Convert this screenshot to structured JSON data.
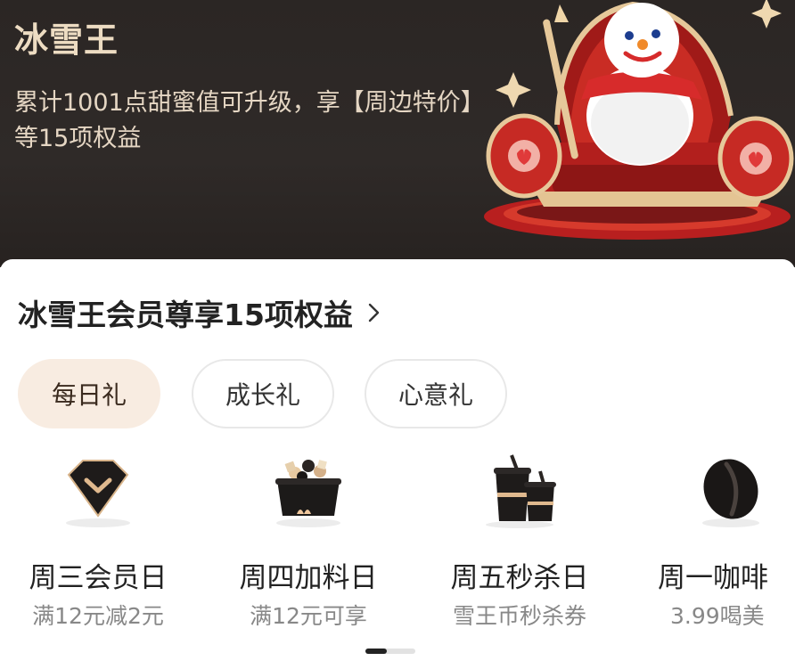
{
  "hero": {
    "title": "冰雪王",
    "subtitle": "累计1001点甜蜜值可升级，享【周边特价】等15项权益"
  },
  "section": {
    "title": "冰雪王会员尊享15项权益"
  },
  "tabs": [
    {
      "label": "每日礼",
      "active": true
    },
    {
      "label": "成长礼",
      "active": false
    },
    {
      "label": "心意礼",
      "active": false
    }
  ],
  "benefits": [
    {
      "name": "周三会员日",
      "desc": "满12元减2元",
      "icon": "diamond-badge-icon"
    },
    {
      "name": "周四加料日",
      "desc": "满12元可享",
      "icon": "toppings-basket-icon"
    },
    {
      "name": "周五秒杀日",
      "desc": "雪王币秒杀券",
      "icon": "cups-icon"
    },
    {
      "name": "周一咖啡",
      "desc": "3.99喝美",
      "icon": "coffee-bean-icon"
    }
  ],
  "colors": {
    "hero_bg": "#2b2624",
    "hero_title": "#eddcc2",
    "active_tab_bg": "#f8ece1"
  }
}
